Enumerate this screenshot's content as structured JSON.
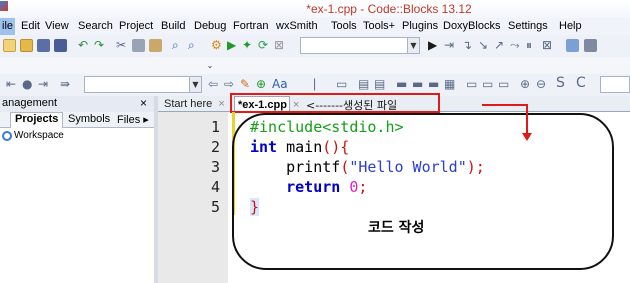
{
  "window": {
    "title": "*ex-1.cpp - Code::Blocks 13.12"
  },
  "menu": [
    "ile",
    "Edit",
    "View",
    "Search",
    "Project",
    "Build",
    "Debug",
    "Fortran",
    "wxSmith",
    "Tools",
    "Tools+",
    "Plugins",
    "DoxyBlocks",
    "Settings",
    "Help"
  ],
  "management": {
    "title": "anagement",
    "close": "×",
    "tabs": [
      "Projects",
      "Symbols",
      "Files ▸"
    ],
    "tree_root": "Workspace"
  },
  "editor": {
    "tabs": [
      {
        "label": "Start here",
        "close": "×"
      },
      {
        "label": "*ex-1.cpp",
        "close": "×"
      }
    ],
    "annotation": "<-------생성된 파일",
    "line_numbers": [
      "1",
      "2",
      "3",
      "4",
      "5"
    ],
    "code": {
      "l1": "#include<stdio.h>",
      "l2_kw": "int",
      "l2_id": " main",
      "l2_paren": "(){",
      "l3_fn": "printf",
      "l3_open": "(",
      "l3_str": "\"Hello World\"",
      "l3_close": ");",
      "l4_kw": "return",
      "l4_num": " 0",
      "l4_semi": ";",
      "l5": "}"
    },
    "callout": "코드 작성"
  },
  "colors": {
    "annotation_red": "#e01919",
    "title_red": "#c0392b",
    "change_bar": "#e8d22b"
  }
}
